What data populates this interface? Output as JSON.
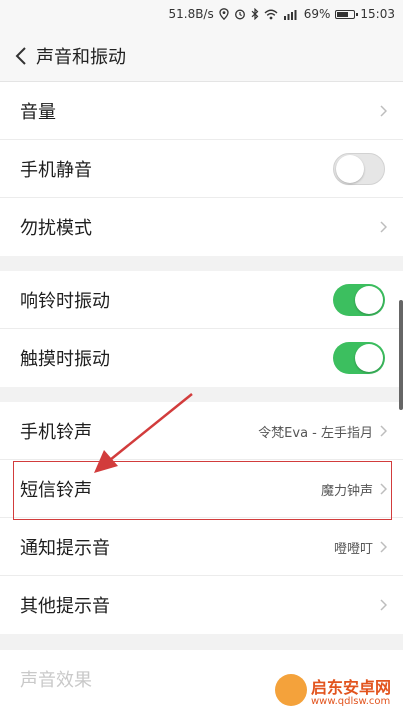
{
  "status_bar": {
    "speed": "51.8B/s",
    "battery_percent": "69%",
    "battery_level": 0.69,
    "time": "15:03",
    "icons": [
      "location-icon",
      "alarm-icon",
      "bluetooth-icon",
      "wifi-icon",
      "signal-icon",
      "battery-icon"
    ]
  },
  "header": {
    "title": "声音和振动"
  },
  "groups": [
    {
      "rows": [
        {
          "label": "音量",
          "control": "chevron"
        },
        {
          "label": "手机静音",
          "control": "toggle",
          "on": false
        },
        {
          "label": "勿扰模式",
          "control": "chevron"
        }
      ]
    },
    {
      "rows": [
        {
          "label": "响铃时振动",
          "control": "toggle",
          "on": true
        },
        {
          "label": "触摸时振动",
          "control": "toggle",
          "on": true
        }
      ]
    },
    {
      "rows": [
        {
          "label": "手机铃声",
          "value": "令梵Eva - 左手指月",
          "control": "chevron"
        },
        {
          "label": "短信铃声",
          "value": "魔力钟声",
          "control": "chevron",
          "highlighted": true
        },
        {
          "label": "通知提示音",
          "value": "噔噔叮",
          "control": "chevron"
        },
        {
          "label": "其他提示音",
          "control": "chevron"
        }
      ]
    },
    {
      "rows": [
        {
          "label": "声音效果",
          "control": "none",
          "disabled": true
        }
      ]
    }
  ],
  "watermark": {
    "title": "启东安卓网",
    "url": "www.qdlsw.com"
  },
  "colors": {
    "toggle_on": "#3cbf5f",
    "annotation": "#d23c3c"
  }
}
